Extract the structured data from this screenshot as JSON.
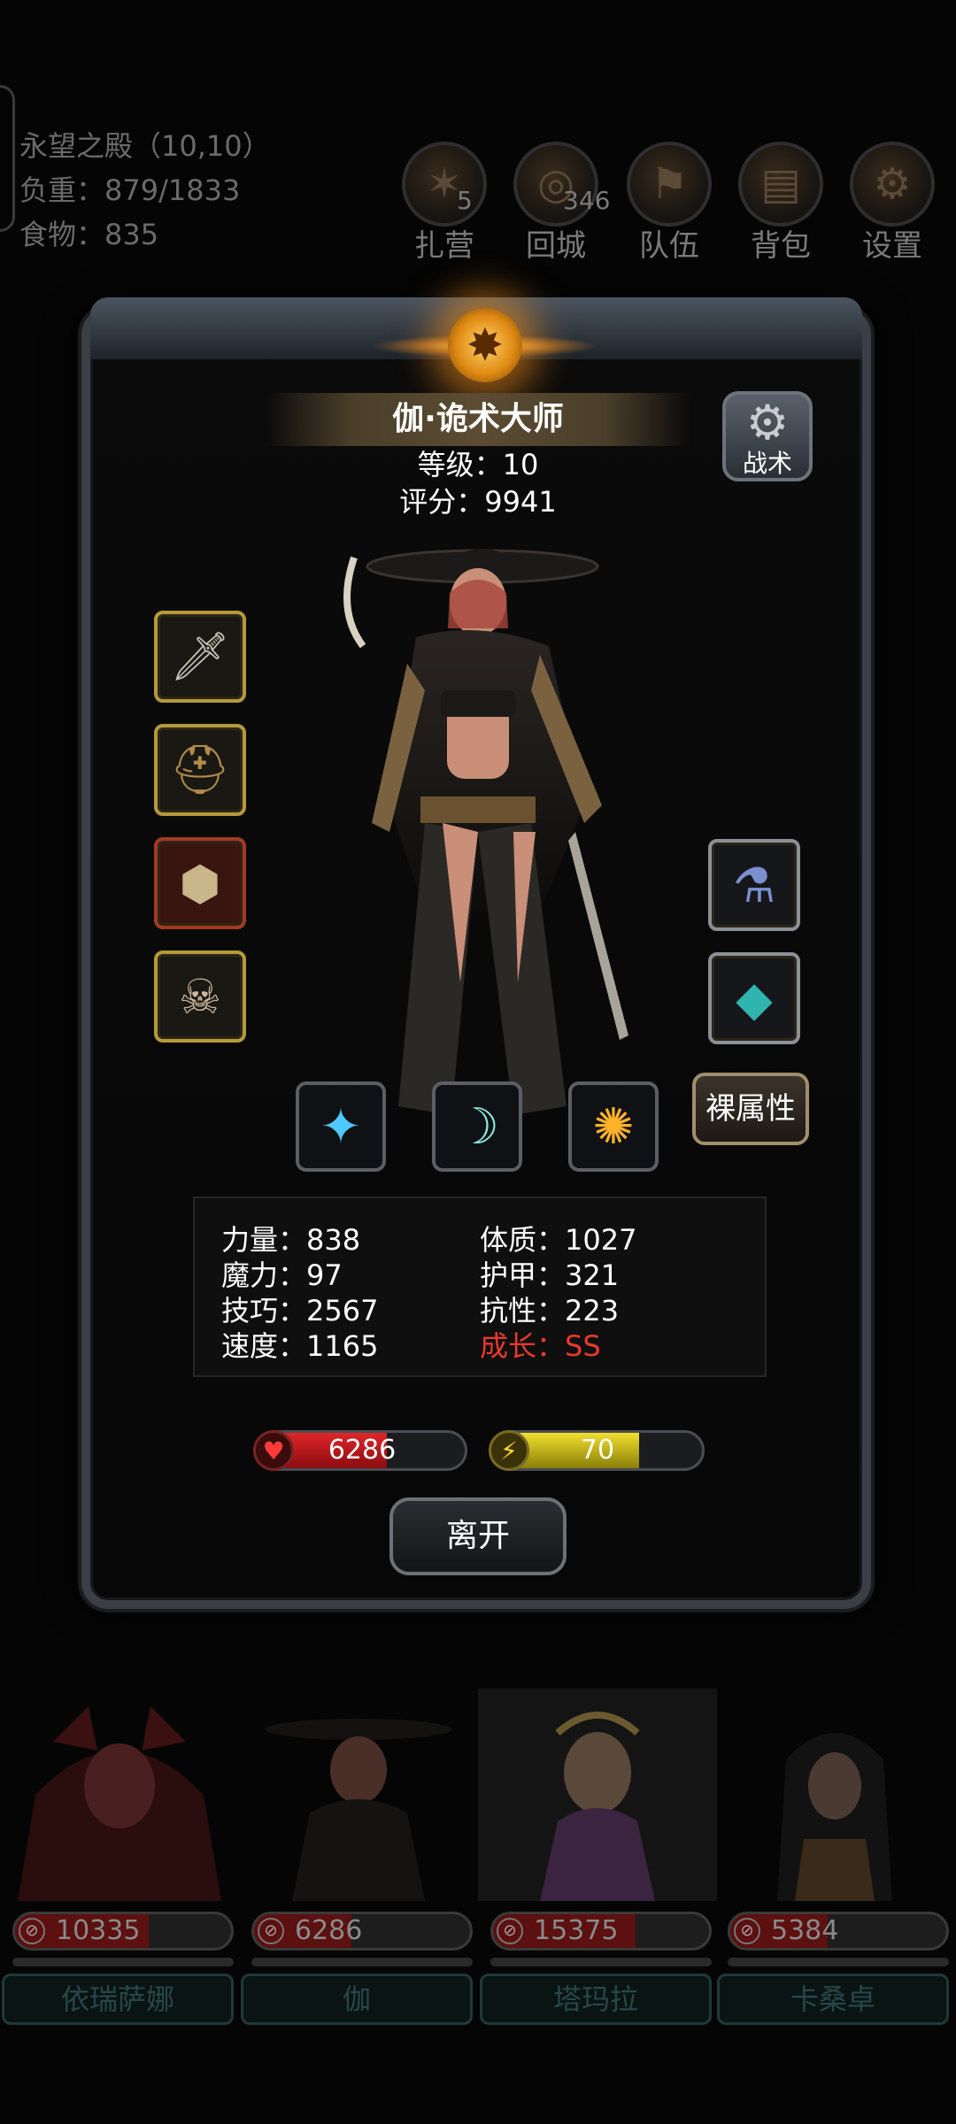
{
  "hud": {
    "location": "永望之殿（10,10）",
    "weight": "负重：879/1833",
    "food": "食物：835"
  },
  "menu": [
    {
      "id": "camp",
      "label": "扎营",
      "badge": "5",
      "icon": "campfire-icon"
    },
    {
      "id": "town",
      "label": "回城",
      "badge": "346",
      "icon": "portal-icon"
    },
    {
      "id": "team",
      "label": "队伍",
      "badge": "",
      "icon": "team-icon"
    },
    {
      "id": "bag",
      "label": "背包",
      "badge": "",
      "icon": "backpack-icon"
    },
    {
      "id": "settings",
      "label": "设置",
      "badge": "",
      "icon": "gear-icon"
    }
  ],
  "hero": {
    "name": "伽·诡术大师",
    "level": "等级：10",
    "score": "评分：9941"
  },
  "tactic_label": "战术",
  "naked_attr_label": "裸属性",
  "equipment_left": [
    {
      "icon": "dagger-icon",
      "symbol": "🗡"
    },
    {
      "icon": "helmet-icon",
      "symbol": "⛑"
    },
    {
      "icon": "ring-icon",
      "symbol": "⬢"
    },
    {
      "icon": "mask-icon",
      "symbol": "☠"
    }
  ],
  "equipment_right": [
    {
      "icon": "potion-icon",
      "symbol": "⚗"
    },
    {
      "icon": "gem-icon",
      "symbol": "◆"
    }
  ],
  "skills": [
    {
      "icon": "light-beam-skill-icon",
      "symbol": "✦"
    },
    {
      "icon": "slash-skill-icon",
      "symbol": "☽"
    },
    {
      "icon": "fire-burst-skill-icon",
      "symbol": "✺"
    }
  ],
  "stats": {
    "strength": "力量：838",
    "magic": "魔力：97",
    "skill": "技巧：2567",
    "speed": "速度：1165",
    "constitution": "体质：1027",
    "armor": "护甲：321",
    "resistance": "抗性：223",
    "growth": "成长：SS"
  },
  "hp_bar": {
    "value": "6286",
    "fill_fraction": 0.62
  },
  "energy_bar": {
    "value": "70",
    "fill_fraction": 0.7
  },
  "leave_label": "离开",
  "colors": {
    "hp": "#c0141a",
    "energy": "#d6c81c",
    "growth": "#e73a2c",
    "frame": "#3b3f45"
  },
  "roster": [
    {
      "name": "依瑞萨娜",
      "hp": "10335",
      "fill_fraction": 0.62
    },
    {
      "name": "伽",
      "hp": "6286",
      "fill_fraction": 0.45
    },
    {
      "name": "塔玛拉",
      "hp": "15375",
      "fill_fraction": 0.66
    },
    {
      "name": "卡桑卓",
      "hp": "5384",
      "fill_fraction": 0.45
    }
  ]
}
